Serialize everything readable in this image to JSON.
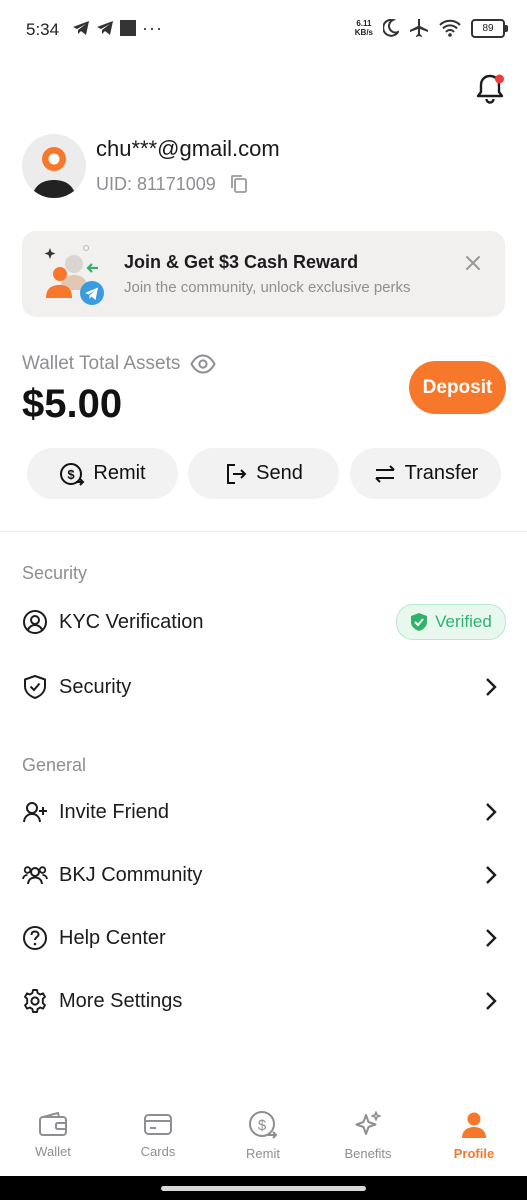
{
  "status": {
    "time": "5:34",
    "net_speed_value": "6.11",
    "net_speed_unit": "KB/s",
    "battery": "89"
  },
  "profile": {
    "email": "chu***@gmail.com",
    "uid": "UID: 81171009"
  },
  "banner": {
    "title": "Join & Get $3 Cash Reward",
    "subtitle": "Join the community, unlock exclusive perks"
  },
  "wallet": {
    "label": "Wallet Total Assets",
    "amount": "$5.00",
    "deposit_label": "Deposit",
    "actions": [
      "Remit",
      "Send",
      "Transfer"
    ]
  },
  "security_section": {
    "title": "Security",
    "items": [
      {
        "label": "KYC Verification",
        "badge": "Verified"
      },
      {
        "label": "Security"
      }
    ]
  },
  "general_section": {
    "title": "General",
    "items": [
      {
        "label": "Invite Friend"
      },
      {
        "label": "BKJ Community"
      },
      {
        "label": "Help Center"
      },
      {
        "label": "More Settings"
      }
    ]
  },
  "nav": {
    "items": [
      {
        "label": "Wallet",
        "icon": "wallet-icon"
      },
      {
        "label": "Cards",
        "icon": "card-icon"
      },
      {
        "label": "Remit",
        "icon": "remit-icon"
      },
      {
        "label": "Benefits",
        "icon": "sparkle-icon"
      },
      {
        "label": "Profile",
        "icon": "person-icon",
        "active": true
      }
    ]
  },
  "colors": {
    "accent": "#f7782a",
    "verified": "#2fb36b"
  }
}
